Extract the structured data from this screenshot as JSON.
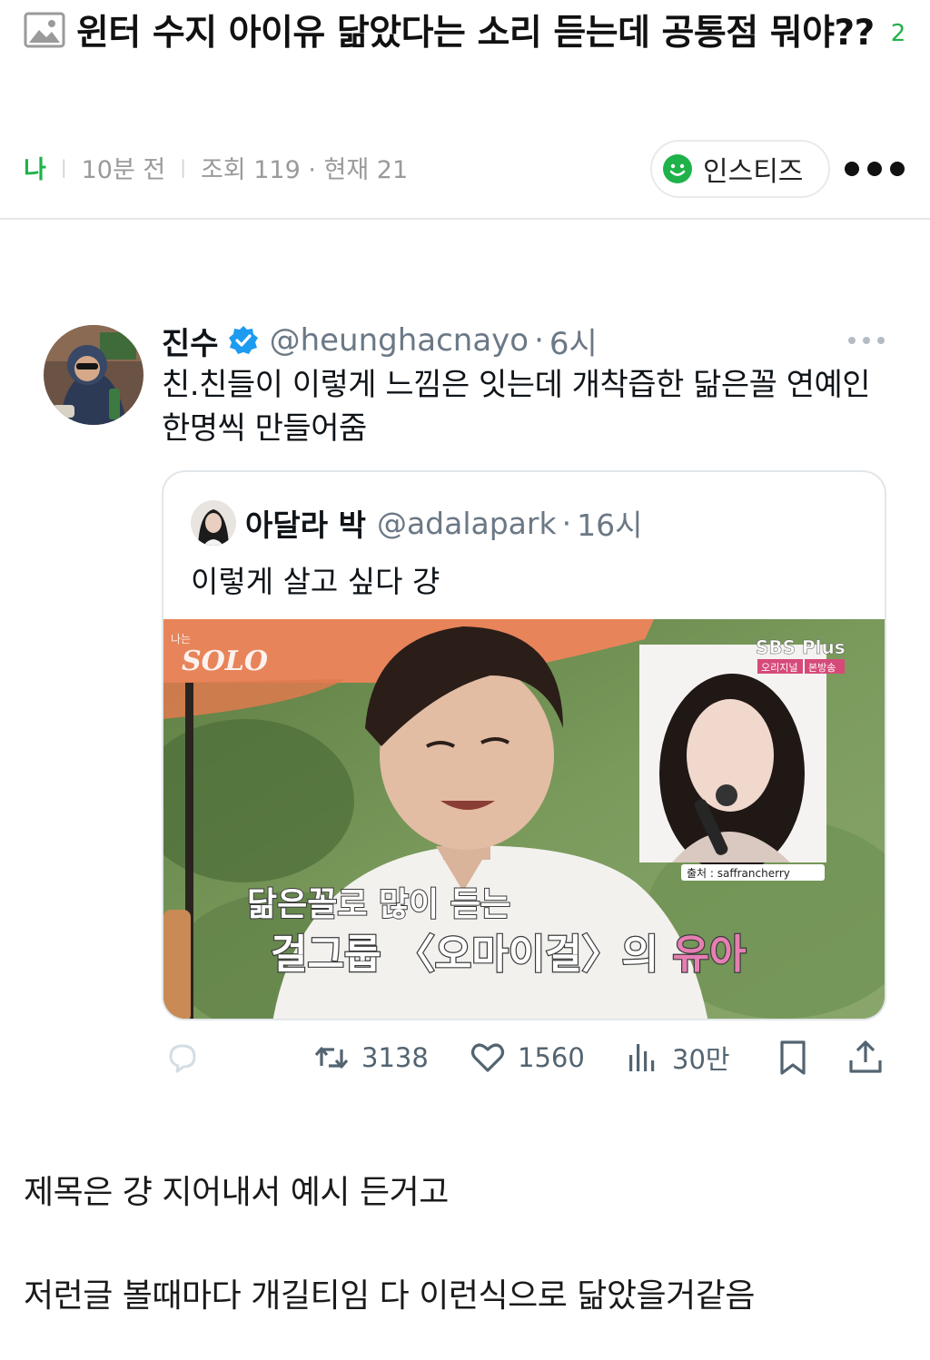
{
  "header": {
    "title": "윈터 수지 아이유 닮았다는 소리 듣는데 공통점 뭐야??",
    "comment_count": "2",
    "author": "나",
    "time_ago": "10분 전",
    "views": "조회 119 · 현재 21",
    "community": "인스티즈",
    "icons": [
      "image-icon",
      "smile-icon",
      "more-icon"
    ],
    "accent_color": "#1fb24a"
  },
  "tweet": {
    "name": "진수",
    "handle": "@heunghacnayo",
    "dot": "·",
    "time": "6시",
    "text": "친.친들이 이렇게 느낌은 잇는데 개착즙한 닮은꼴 연예인 한명씩 만들어줌",
    "quote": {
      "name": "아달라 박",
      "handle": "@adalapark",
      "time": "16시",
      "text": "이렇게 살고 싶다 걍",
      "media": {
        "show_logo_small": "나는",
        "show_logo": "SOLO",
        "channel_logo": "SBS Plus",
        "channel_tag1": "오리지널",
        "channel_tag2": "본방송",
        "source_credit": "출처 : saffrancherry",
        "caption_line1": "닮은꼴로 많이 듣는",
        "caption_line2_prefix": "걸그룹 〈오마이걸〉의 ",
        "caption_line2_highlight": "유아"
      }
    },
    "actions": {
      "retweets": "3138",
      "likes": "1560",
      "views": "30만"
    }
  },
  "body": {
    "paragraphs": [
      "제목은 걍 지어내서 예시 든거고",
      "저런글 볼때마다 개길티임 다 이런식으로 닮았을거같음"
    ]
  }
}
